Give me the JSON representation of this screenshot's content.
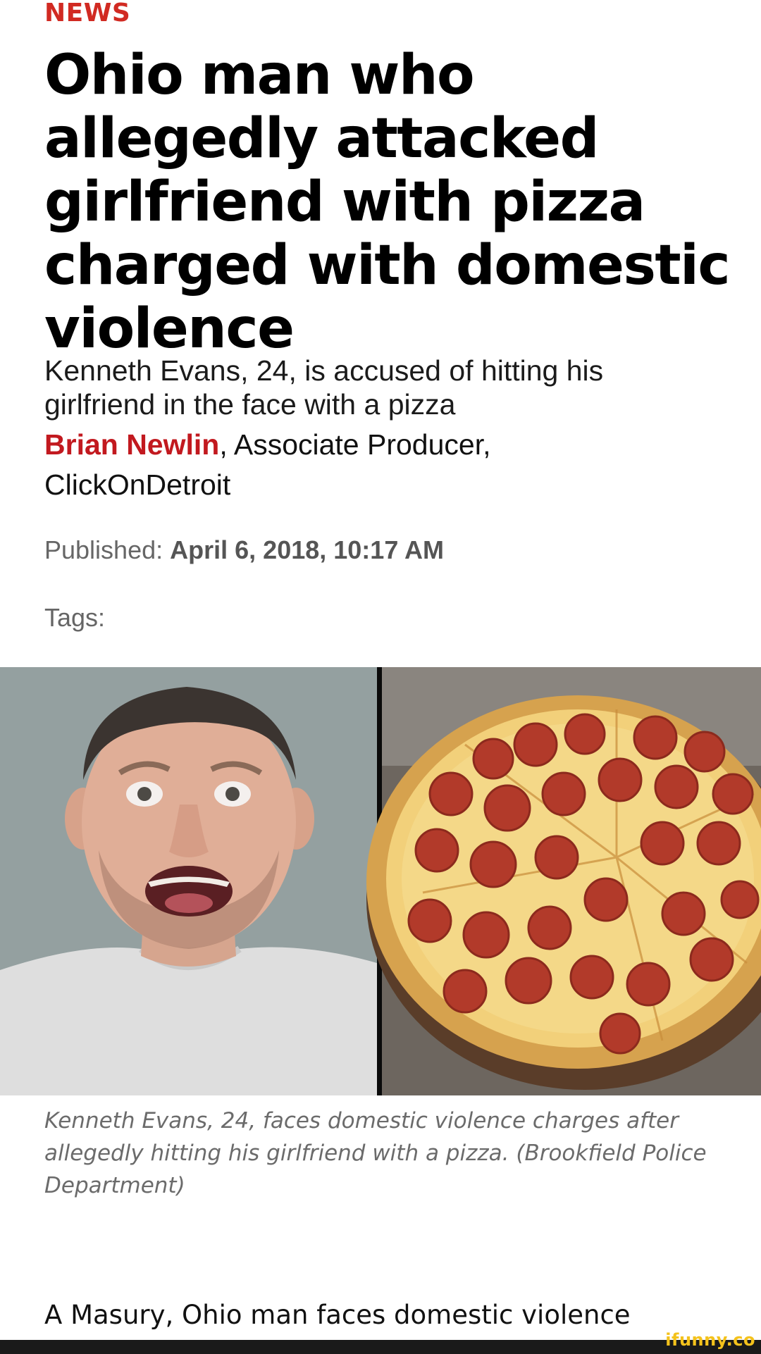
{
  "article": {
    "section": "NEWS",
    "headline": "Ohio man who allegedly attacked girlfriend with pizza charged with domestic violence",
    "subheadline": "Kenneth Evans, 24, is accused of hitting his girlfriend in the face with a pizza",
    "byline": {
      "author": "Brian Newlin",
      "role": ", Associate Producer,",
      "outlet": "ClickOnDetroit"
    },
    "published": {
      "label": "Published:",
      "date": "April 6, 2018, 10:17 AM"
    },
    "tags_label": "Tags:",
    "image_caption": "Kenneth Evans, 24, faces domestic violence charges after allegedly hitting his girlfriend with a pizza. (Brookfield Police Department)",
    "body_start": "A Masury, Ohio man faces domestic violence"
  },
  "watermark": "ifunny.co",
  "colors": {
    "accent_red": "#c2191f",
    "text": "#111111",
    "muted": "#666666",
    "watermark": "#f4c21c"
  }
}
